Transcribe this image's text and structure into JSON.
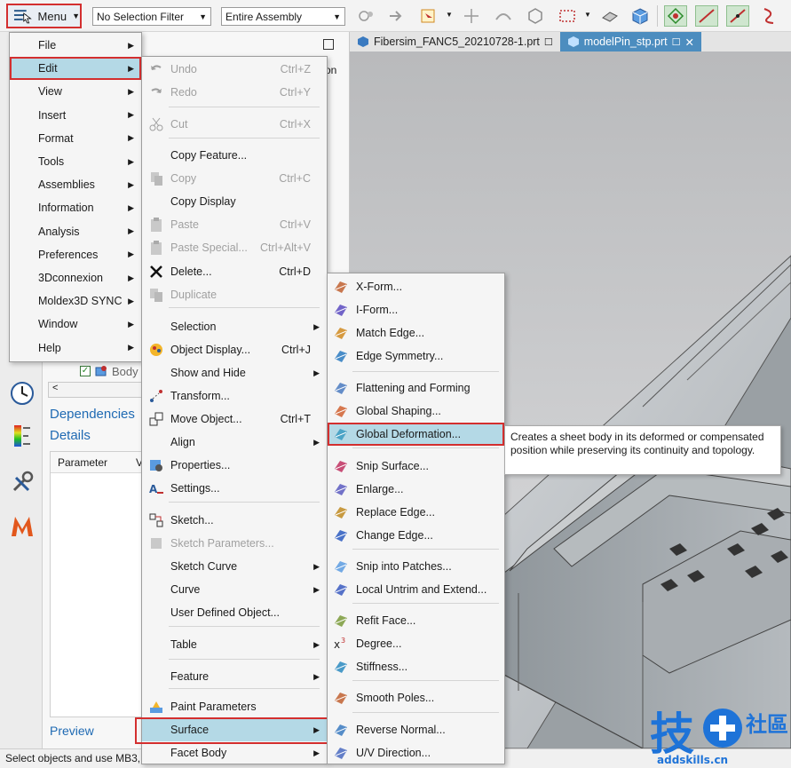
{
  "toolbar": {
    "menu_label": "Menu",
    "selection_filter": "No Selection Filter",
    "scope": "Entire Assembly"
  },
  "tabs": [
    {
      "label": "Fibersim_FANC5_20210728-1.prt"
    },
    {
      "label": "modelPin_stp.prt"
    }
  ],
  "nav": {
    "column_head": "on",
    "body_label": "Body",
    "scroll_text": "<",
    "dependencies": "Dependencies",
    "details": "Details",
    "param_header": "Parameter",
    "param_header2": "V",
    "preview": "Preview"
  },
  "main_menu": [
    {
      "label": "File",
      "icon": "file-icon"
    },
    {
      "label": "Edit",
      "icon": "edit-icon"
    },
    {
      "label": "View",
      "icon": "view-icon"
    },
    {
      "label": "Insert",
      "icon": "insert-icon"
    },
    {
      "label": "Format",
      "icon": "format-icon"
    },
    {
      "label": "Tools",
      "icon": "tools-icon"
    },
    {
      "label": "Assemblies",
      "icon": "assemblies-icon"
    },
    {
      "label": "Information",
      "icon": "information-icon"
    },
    {
      "label": "Analysis",
      "icon": "analysis-icon"
    },
    {
      "label": "Preferences",
      "icon": "preferences-icon"
    },
    {
      "label": "3Dconnexion",
      "icon": "3dconnexion-icon"
    },
    {
      "label": "Moldex3D SYNC",
      "icon": "moldex-icon"
    },
    {
      "label": "Window",
      "icon": "window-icon"
    },
    {
      "label": "Help",
      "icon": "help-icon"
    }
  ],
  "edit_menu": [
    {
      "label": "Undo",
      "shortcut": "Ctrl+Z",
      "disabled": true
    },
    {
      "label": "Redo",
      "shortcut": "Ctrl+Y",
      "disabled": true
    },
    {
      "label": "Cut",
      "shortcut": "Ctrl+X",
      "disabled": true
    },
    {
      "label": "Copy Feature...",
      "shortcut": "",
      "disabled": false
    },
    {
      "label": "Copy",
      "shortcut": "Ctrl+C",
      "disabled": true
    },
    {
      "label": "Copy Display",
      "shortcut": "",
      "disabled": false
    },
    {
      "label": "Paste",
      "shortcut": "Ctrl+V",
      "disabled": true
    },
    {
      "label": "Paste Special...",
      "shortcut": "Ctrl+Alt+V",
      "disabled": true
    },
    {
      "label": "Delete...",
      "shortcut": "Ctrl+D",
      "disabled": false
    },
    {
      "label": "Duplicate",
      "shortcut": "",
      "disabled": true
    },
    {
      "label": "Selection",
      "shortcut": "",
      "disabled": false
    },
    {
      "label": "Object Display...",
      "shortcut": "Ctrl+J",
      "disabled": false
    },
    {
      "label": "Show and Hide",
      "shortcut": "",
      "disabled": false
    },
    {
      "label": "Transform...",
      "shortcut": "",
      "disabled": false
    },
    {
      "label": "Move Object...",
      "shortcut": "Ctrl+T",
      "disabled": false
    },
    {
      "label": "Align",
      "shortcut": "",
      "disabled": false
    },
    {
      "label": "Properties...",
      "shortcut": "",
      "disabled": false
    },
    {
      "label": "Settings...",
      "shortcut": "",
      "disabled": false
    },
    {
      "label": "Sketch...",
      "shortcut": "",
      "disabled": false
    },
    {
      "label": "Sketch Parameters...",
      "shortcut": "",
      "disabled": true
    },
    {
      "label": "Sketch Curve",
      "shortcut": "",
      "disabled": false
    },
    {
      "label": "Curve",
      "shortcut": "",
      "disabled": false
    },
    {
      "label": "User Defined Object...",
      "shortcut": "",
      "disabled": false
    },
    {
      "label": "Table",
      "shortcut": "",
      "disabled": false
    },
    {
      "label": "Feature",
      "shortcut": "",
      "disabled": false
    },
    {
      "label": "Paint Parameters",
      "shortcut": "",
      "disabled": false
    },
    {
      "label": "Surface",
      "shortcut": "",
      "disabled": false
    },
    {
      "label": "Facet Body",
      "shortcut": "",
      "disabled": false
    }
  ],
  "surface_menu": [
    {
      "label": "X-Form..."
    },
    {
      "label": "I-Form..."
    },
    {
      "label": "Match Edge..."
    },
    {
      "label": "Edge Symmetry..."
    },
    {
      "label": "Flattening and Forming"
    },
    {
      "label": "Global Shaping..."
    },
    {
      "label": "Global Deformation..."
    },
    {
      "label": "Snip Surface..."
    },
    {
      "label": "Enlarge..."
    },
    {
      "label": "Replace Edge..."
    },
    {
      "label": "Change Edge..."
    },
    {
      "label": "Snip into Patches..."
    },
    {
      "label": "Local Untrim and Extend..."
    },
    {
      "label": "Refit Face..."
    },
    {
      "label": "Degree..."
    },
    {
      "label": "Stiffness..."
    },
    {
      "label": "Smooth Poles..."
    },
    {
      "label": "Reverse Normal..."
    },
    {
      "label": "U/V Direction..."
    }
  ],
  "tooltip": "Creates a sheet body in its deformed or compensated position while preserving its continuity and topology.",
  "status": "Select objects and use MB3,",
  "watermark": {
    "brand_left": "技",
    "brand_right": "社區",
    "url": "addskills.cn"
  }
}
